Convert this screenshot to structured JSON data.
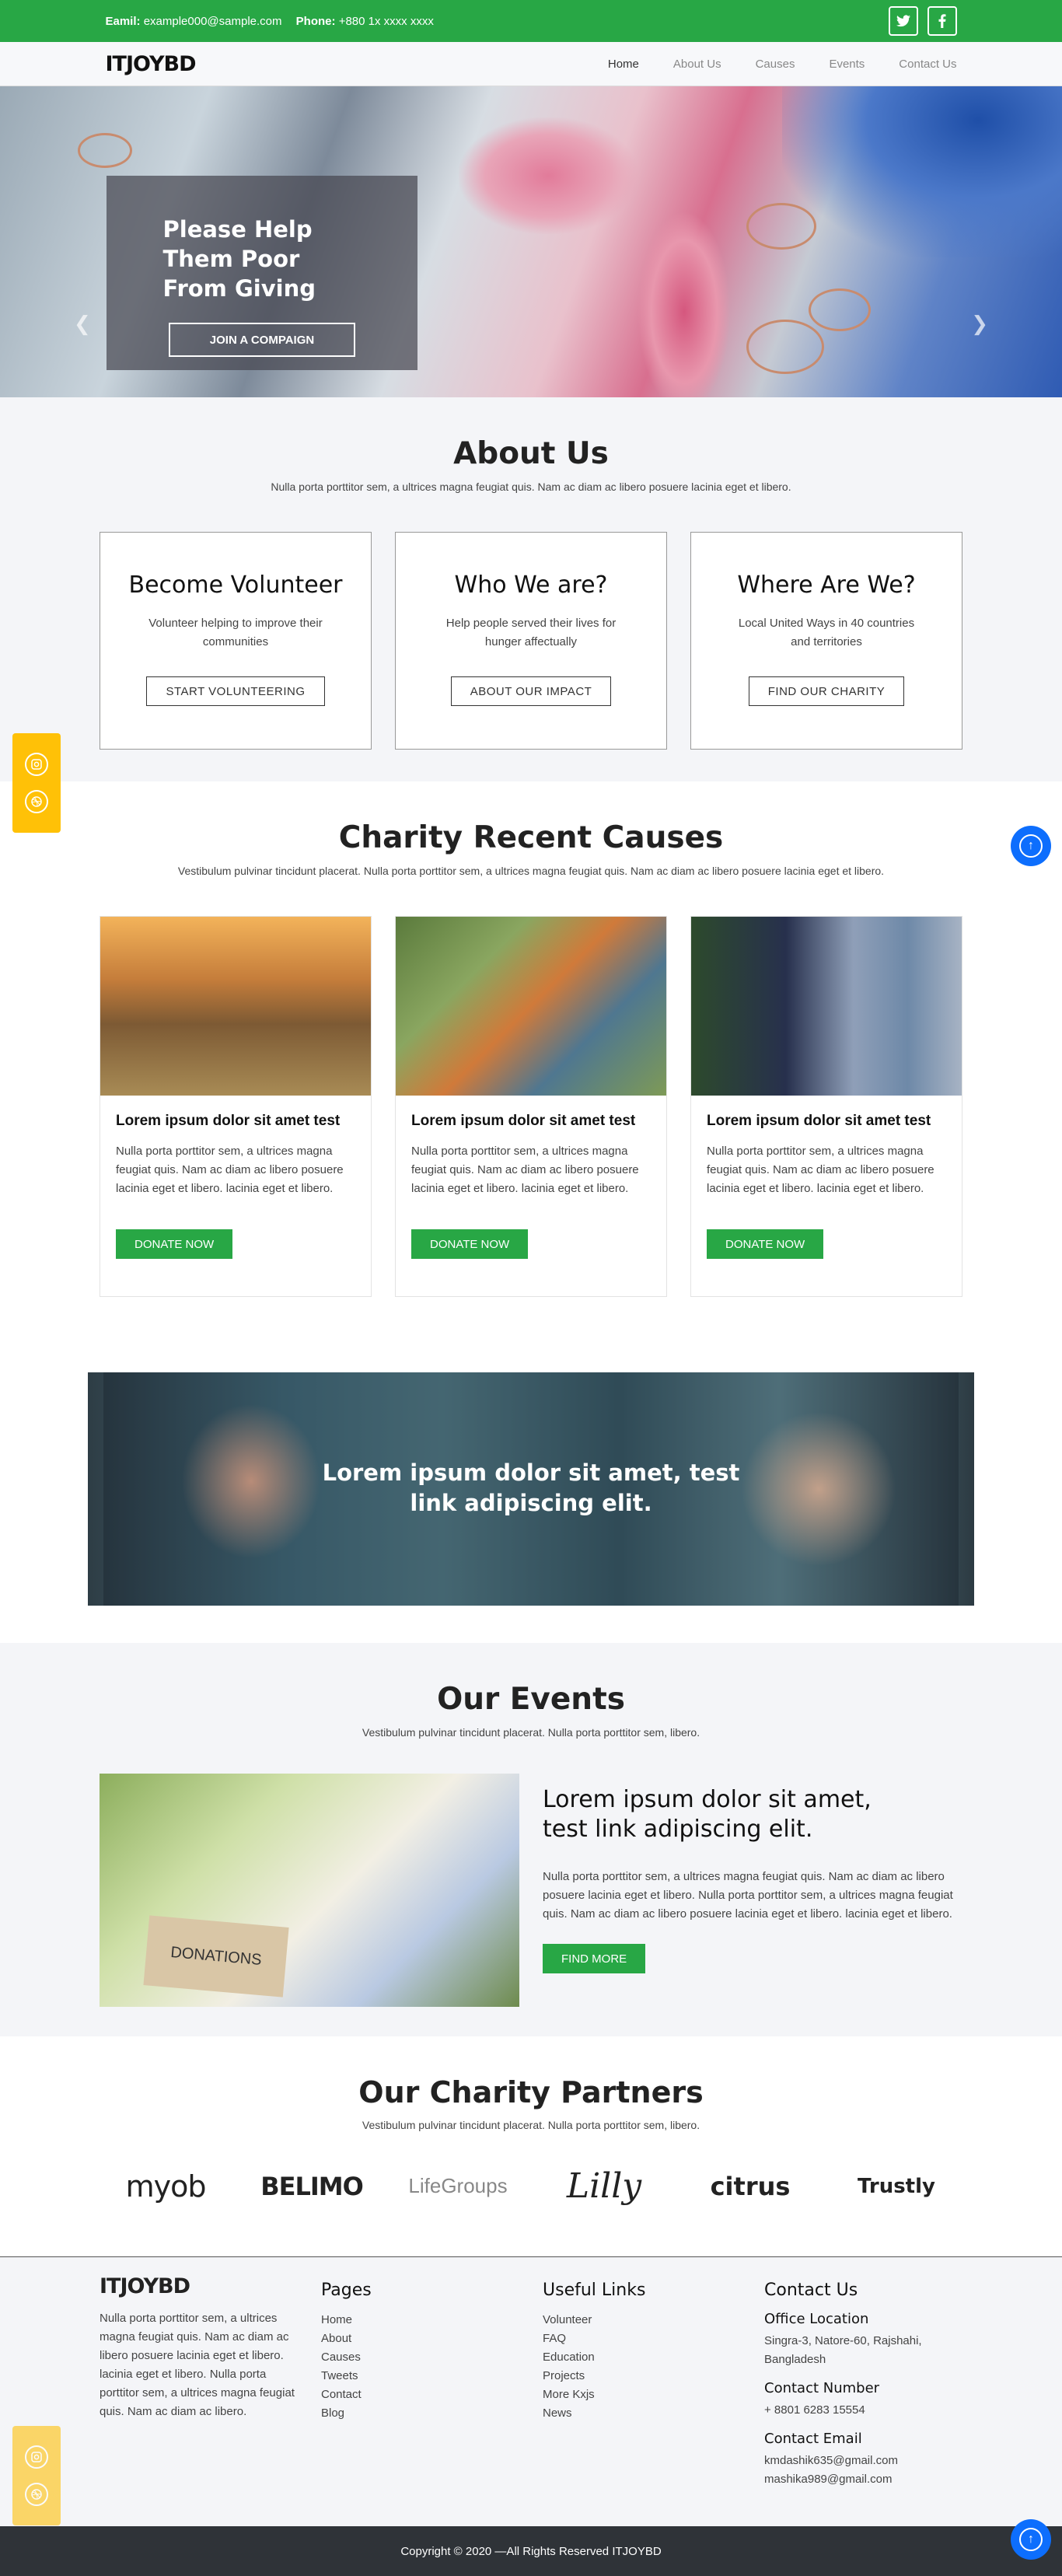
{
  "topbar": {
    "email_label": "Eamil:",
    "email": "example000@sample.com",
    "phone_label": "Phone:",
    "phone": "+880 1x xxxx xxxx",
    "social_icons": [
      "twitter-icon",
      "facebook-icon"
    ]
  },
  "navbar": {
    "logo": "ITJOYBD",
    "items": [
      {
        "label": "Home"
      },
      {
        "label": "About Us"
      },
      {
        "label": "Causes"
      },
      {
        "label": "Events"
      },
      {
        "label": "Contact Us"
      }
    ],
    "active_index": 0
  },
  "hero": {
    "title": "Please Help Them Poor From Giving",
    "button": "JOIN A COMPAIGN",
    "prev_icon": "chevron-left-icon",
    "next_icon": "chevron-right-icon"
  },
  "about": {
    "title": "About Us",
    "subtitle": "Nulla porta porttitor sem, a ultrices magna feugiat quis. Nam ac diam ac libero posuere lacinia eget et libero.",
    "cards": [
      {
        "title": "Become Volunteer",
        "text": "Volunteer helping to improve their communities",
        "button": "START VOLUNTEERING"
      },
      {
        "title": "Who We are?",
        "text": "Help people served their lives for hunger affectually",
        "button": "ABOUT OUR IMPACT"
      },
      {
        "title": "Where Are We?",
        "text": "Local United Ways in 40 countries and territories",
        "button": "FIND OUR CHARITY"
      }
    ]
  },
  "causes": {
    "title": "Charity Recent Causes",
    "subtitle": "Vestibulum pulvinar tincidunt placerat. Nulla porta porttitor sem, a ultrices magna feugiat quis. Nam ac diam ac libero posuere lacinia eget et libero.",
    "cards": [
      {
        "title": "Lorem ipsum dolor sit amet test",
        "text": "Nulla porta porttitor sem, a ultrices magna feugiat quis. Nam ac diam ac libero posuere lacinia eget et libero. lacinia eget et libero.",
        "button": "DONATE NOW"
      },
      {
        "title": "Lorem ipsum dolor sit amet test",
        "text": "Nulla porta porttitor sem, a ultrices magna feugiat quis. Nam ac diam ac libero posuere lacinia eget et libero. lacinia eget et libero.",
        "button": "DONATE NOW"
      },
      {
        "title": "Lorem ipsum dolor sit amet test",
        "text": "Nulla porta porttitor sem, a ultrices magna feugiat quis. Nam ac diam ac libero posuere lacinia eget et libero. lacinia eget et libero.",
        "button": "DONATE NOW"
      }
    ]
  },
  "banner": {
    "text": "Lorem ipsum dolor sit amet, test link adipiscing elit."
  },
  "events": {
    "title": "Our Events",
    "subtitle": "Vestibulum pulvinar tincidunt placerat. Nulla porta porttitor sem, libero.",
    "image_caption": "DONATIONS",
    "heading": "Lorem ipsum dolor sit amet, test link adipiscing elit.",
    "text": "Nulla porta porttitor sem, a ultrices magna feugiat quis. Nam ac diam ac libero posuere lacinia eget et libero. Nulla porta porttitor sem, a ultrices magna feugiat quis. Nam ac diam ac libero posuere lacinia eget et libero. lacinia eget et libero.",
    "button": "FIND MORE"
  },
  "partners": {
    "title": "Our Charity Partners",
    "subtitle": "Vestibulum pulvinar tincidunt placerat. Nulla porta porttitor sem, libero.",
    "logos": [
      "myob",
      "BELIMO",
      "LifeGroups",
      "Lilly",
      "citrus",
      "Trustly"
    ]
  },
  "footer": {
    "logo": "ITJOYBD",
    "about": "Nulla porta porttitor sem, a ultrices magna feugiat quis. Nam ac diam ac libero posuere lacinia eget et libero. lacinia eget et libero. Nulla porta porttitor sem, a ultrices magna feugiat quis. Nam ac diam ac libero.",
    "pages_title": "Pages",
    "pages": [
      "Home",
      "About",
      "Causes",
      "Tweets",
      "Contact",
      "Blog"
    ],
    "links_title": "Useful Links",
    "links": [
      "Volunteer",
      "FAQ",
      "Education",
      "Projects",
      "More Kxjs",
      "News"
    ],
    "contact_title": "Contact Us",
    "office_title": "Office Location",
    "office": "Singra-3, Natore-60, Rajshahi, Bangladesh",
    "number_title": "Contact Number",
    "number": "+ 8801 6283 15554",
    "email_title": "Contact Email",
    "emails": [
      "kmdashik635@gmail.com",
      "mashika989@gmail.com"
    ]
  },
  "copyright": "Copyright © 2020 —All Rights Reserved ITJOYBD",
  "colors": {
    "brand_green": "#28a745",
    "side_yellow": "#ffc107",
    "scroll_blue": "#0d6efd",
    "footer_dark": "#2f3338"
  },
  "side_social_icons": [
    "instagram-icon",
    "dribbble-icon"
  ],
  "scroll_top_icon": "arrow-up-icon"
}
